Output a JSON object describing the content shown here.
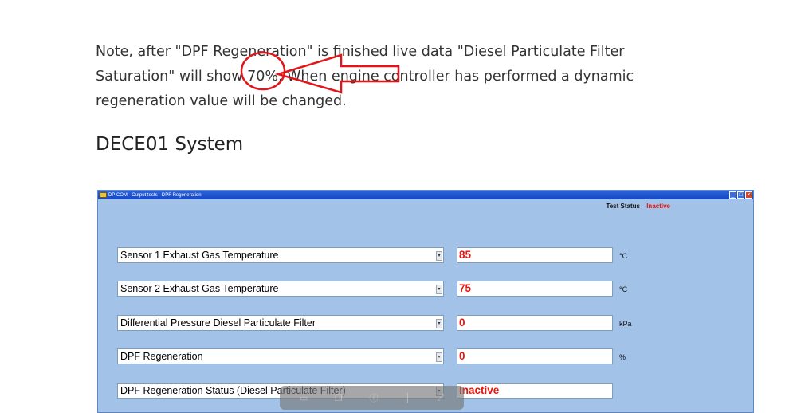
{
  "article": {
    "note_line1": "Note, after \"DPF Regeneration\" is finished live data \"Diesel Particulate Filter",
    "note_line2": "Saturation\" will show 70%. When engine controller has performed a dynamic",
    "note_line3": "regeneration value will be changed.",
    "section_heading": "DECE01 System"
  },
  "annotation": {
    "circle_color": "#e0161b",
    "arrow_color": "#e0161b"
  },
  "window": {
    "title": "DP COM - Output tests - DPF Regeneration",
    "buttons": {
      "minimize": "_",
      "maximize": "□",
      "close": "×"
    },
    "test_status_label": "Test Status",
    "test_status_value": "Inactive",
    "rows": [
      {
        "label": "Sensor 1 Exhaust Gas Temperature",
        "value": "85",
        "unit": "°C"
      },
      {
        "label": "Sensor 2 Exhaust Gas Temperature",
        "value": "75",
        "unit": "°C"
      },
      {
        "label": "Differential Pressure Diesel Particulate Filter",
        "value": "0",
        "unit": "kPa"
      },
      {
        "label": "DPF Regeneration",
        "value": "0",
        "unit": "%"
      },
      {
        "label": "DPF Regeneration Status (Diesel Particulate Filter)",
        "value": "Inactive",
        "unit": ""
      }
    ]
  },
  "viewer_toolbar": {
    "icons": [
      "page-icon",
      "copy-icon",
      "info-icon",
      "divider-icon",
      "fullscreen-icon"
    ]
  }
}
